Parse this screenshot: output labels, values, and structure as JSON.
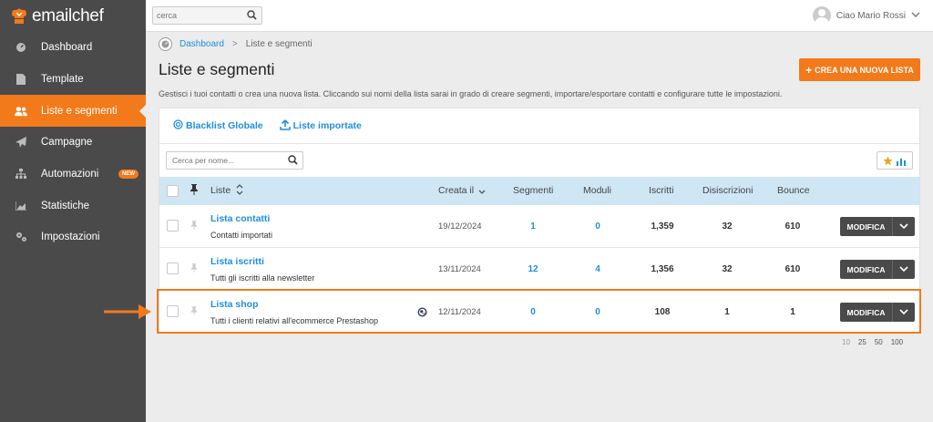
{
  "app": {
    "brand": "emailchef"
  },
  "sidebar": {
    "items": [
      {
        "label": "Dashboard",
        "icon": "dashboard-gauge-icon"
      },
      {
        "label": "Template",
        "icon": "document-icon"
      },
      {
        "label": "Liste e segmenti",
        "icon": "users-icon",
        "active": true
      },
      {
        "label": "Campagne",
        "icon": "paper-plane-icon"
      },
      {
        "label": "Automazioni",
        "icon": "sitemap-icon",
        "badge": "NEW"
      },
      {
        "label": "Statistiche",
        "icon": "chart-icon"
      },
      {
        "label": "Impostazioni",
        "icon": "gears-icon"
      }
    ]
  },
  "topbar": {
    "search_placeholder": "cerca",
    "user_name": "Ciao Mario Rossi"
  },
  "breadcrumb": {
    "home": "Dashboard",
    "current": "Liste e segmenti"
  },
  "page": {
    "title": "Liste e segmenti",
    "create_button": "CREA UNA NUOVA LISTA",
    "description": "Gestisci i tuoi contatti o crea una nuova lista. Cliccando sui nomi della lista sarai in grado di creare segmenti, importare/esportare contatti e configurare tutte le impostazioni."
  },
  "panel": {
    "links": {
      "blacklist": "Blacklist Globale",
      "imported": "Liste importate"
    },
    "name_search_placeholder": "Cerca per nome..."
  },
  "table": {
    "headers": {
      "liste": "Liste",
      "creata": "Creata il",
      "segmenti": "Segmenti",
      "moduli": "Moduli",
      "iscritti": "Iscritti",
      "disiscrizioni": "Disiscrizioni",
      "bounce": "Bounce"
    },
    "rows": [
      {
        "name": "Lista contatti",
        "desc": "Contatti importati",
        "date": "19/12/2024",
        "segmenti": "1",
        "moduli": "0",
        "iscritti": "1,359",
        "disiscrizioni": "32",
        "bounce": "610",
        "action": "MODIFICA"
      },
      {
        "name": "Lista iscritti",
        "desc": "Tutti gli iscritti alla newsletter",
        "date": "13/11/2024",
        "segmenti": "12",
        "moduli": "4",
        "iscritti": "1,356",
        "disiscrizioni": "32",
        "bounce": "610",
        "action": "MODIFICA"
      },
      {
        "name": "Lista shop",
        "desc": "Tutti i clienti relativi all'ecommerce Prestashop",
        "date": "12/11/2024",
        "segmenti": "0",
        "moduli": "0",
        "iscritti": "108",
        "disiscrizioni": "1",
        "bounce": "1",
        "action": "MODIFICA",
        "integration_icon": "prestashop-icon"
      }
    ]
  },
  "pagination": [
    "10",
    "25",
    "50",
    "100"
  ],
  "colors": {
    "accent": "#f27a1a",
    "link": "#1e8fdc",
    "sidebar": "#4a4a4a",
    "header": "#cfe6f5"
  }
}
